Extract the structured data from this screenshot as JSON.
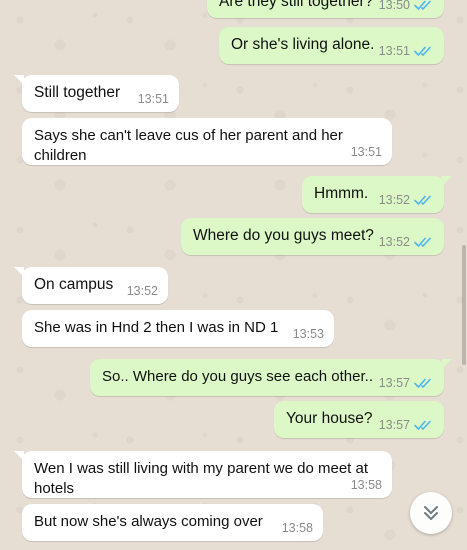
{
  "colors": {
    "incoming_bubble": "#ffffff",
    "outgoing_bubble": "#dcf8c6",
    "read_ticks": "#4fb6ec",
    "background": "#e6ddd3"
  },
  "messages": [
    {
      "dir": "out",
      "text": "Are they still together?",
      "time": "13:50",
      "status": "read"
    },
    {
      "dir": "out",
      "text": "Or she's living alone.",
      "time": "13:51",
      "status": "read"
    },
    {
      "dir": "in",
      "text": "Still together",
      "time": "13:51"
    },
    {
      "dir": "in",
      "text": "Says she can't leave cus of her parent and her children",
      "time": "13:51"
    },
    {
      "dir": "out",
      "text": "Hmmm.",
      "time": "13:52",
      "status": "read"
    },
    {
      "dir": "out",
      "text": "Where do you guys meet?",
      "time": "13:52",
      "status": "read"
    },
    {
      "dir": "in",
      "text": "On campus",
      "time": "13:52"
    },
    {
      "dir": "in",
      "text": "She was in Hnd 2 then I was in ND 1",
      "time": "13:53"
    },
    {
      "dir": "out",
      "text": "So.. Where do you guys see each other..",
      "time": "13:57",
      "status": "read"
    },
    {
      "dir": "out",
      "text": "Your house?",
      "time": "13:57",
      "status": "read"
    },
    {
      "dir": "in",
      "text": "Wen I was still living with my parent we do meet at hotels",
      "time": "13:58"
    },
    {
      "dir": "in",
      "text": "But now she's always coming over",
      "time": "13:58"
    }
  ],
  "scroll_button_icon": "double-chevron-down-icon",
  "read_tick_icon": "double-check-icon"
}
